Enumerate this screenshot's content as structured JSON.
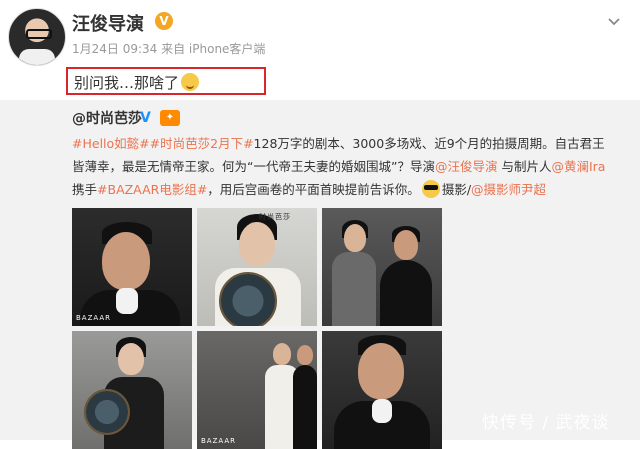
{
  "header": {
    "username": "汪俊导演",
    "meta": "1月24日 09:34 来自 iPhone客户端",
    "post_text": "别问我…那啥了"
  },
  "repost": {
    "username": "@时尚芭莎",
    "body_segments": [
      {
        "text": "#Hello如懿#",
        "kind": "tag"
      },
      {
        "text": "#时尚芭莎2月下#",
        "kind": "tag"
      },
      {
        "text": "128万字的剧本、3000多场戏、近9个月的拍摄周期。自古君王皆薄幸，最是无情帝王家。何为“一代帝王夫妻的婚姻围城”？导演",
        "kind": "text"
      },
      {
        "text": "@汪俊导演",
        "kind": "mention"
      },
      {
        "text": " 与制片人",
        "kind": "text"
      },
      {
        "text": "@黄澜Ira",
        "kind": "mention"
      },
      {
        "text": " 携手",
        "kind": "text"
      },
      {
        "text": "#BAZAAR电影组#",
        "kind": "tag"
      },
      {
        "text": "，用后宫画卷的平面首映提前告诉你。",
        "kind": "text"
      },
      {
        "text": "摄影/",
        "kind": "text"
      },
      {
        "text": "@摄影师尹超",
        "kind": "mention"
      }
    ],
    "photo_labels": [
      "BAZAAR",
      "时尚芭莎",
      "BAZAAR"
    ]
  },
  "watermark": "快传号 / 武夜谈",
  "colors": {
    "accent": "#eb7350",
    "highlight_box": "#d8262c",
    "verified": "#f5a623",
    "repost_bg": "#f2f2f2"
  },
  "icons": {
    "verified": "verified-badge-icon",
    "chevron": "chevron-down-icon",
    "emoji_sweat": "emoji-embarrassed-icon",
    "emoji_cool": "emoji-sunglasses-icon",
    "vip": "vip-badge-icon"
  }
}
